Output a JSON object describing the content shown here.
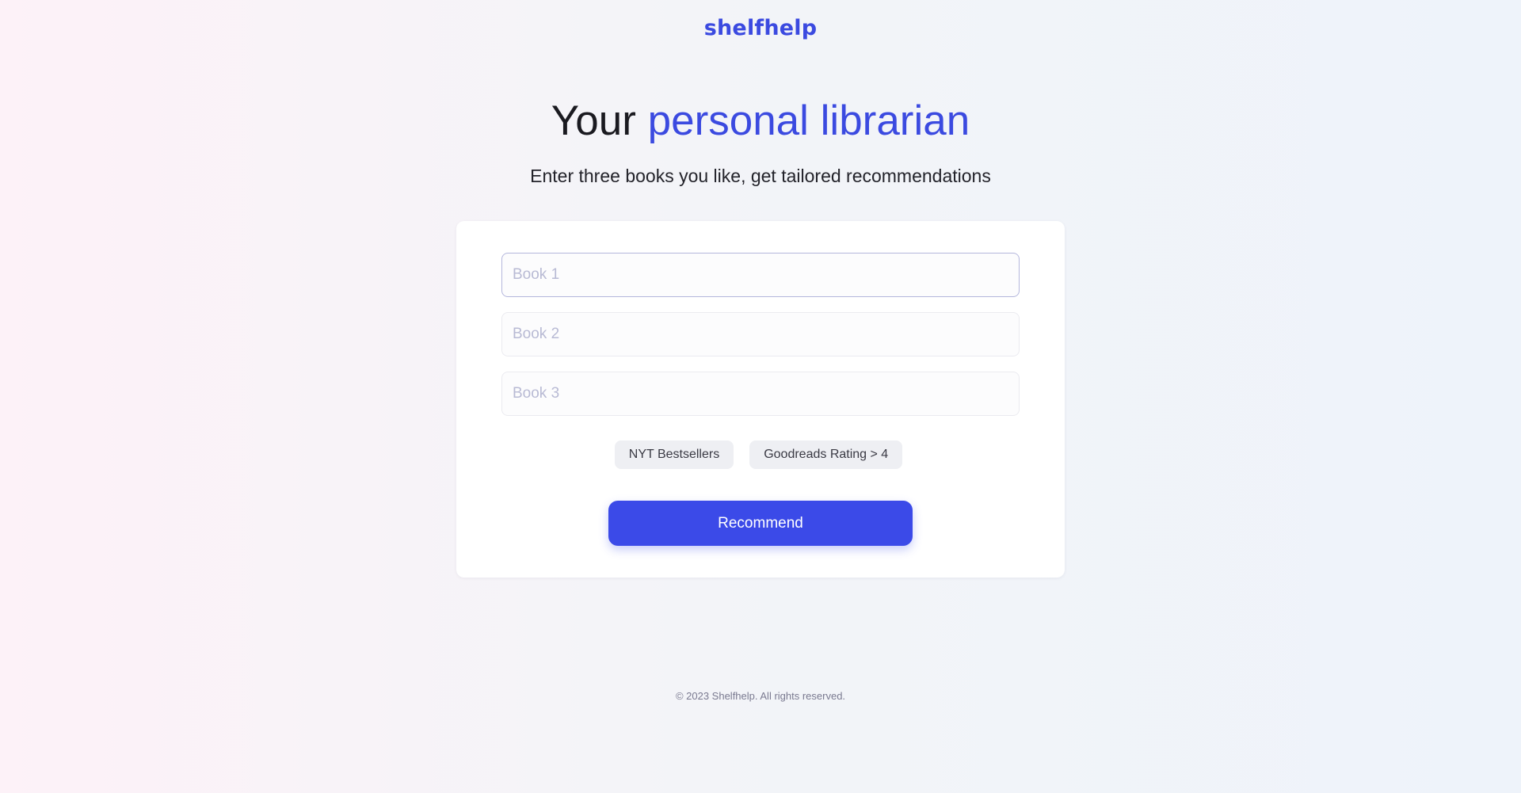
{
  "header": {
    "logo_text": "shelfhelp"
  },
  "hero": {
    "title_prefix": "Your",
    "title_accent": "personal librarian",
    "subtitle": "Enter three books you like, get tailored recommendations"
  },
  "form": {
    "books": [
      {
        "placeholder": "Book 1",
        "value": ""
      },
      {
        "placeholder": "Book 2",
        "value": ""
      },
      {
        "placeholder": "Book 3",
        "value": ""
      }
    ],
    "filters": [
      {
        "label": "NYT Bestsellers"
      },
      {
        "label": "Goodreads Rating > 4"
      }
    ],
    "submit_label": "Recommend"
  },
  "footer": {
    "copyright": "© 2023 Shelfhelp. All rights reserved."
  },
  "colors": {
    "accent": "#3b4ae0",
    "button": "#3b4ae8"
  }
}
